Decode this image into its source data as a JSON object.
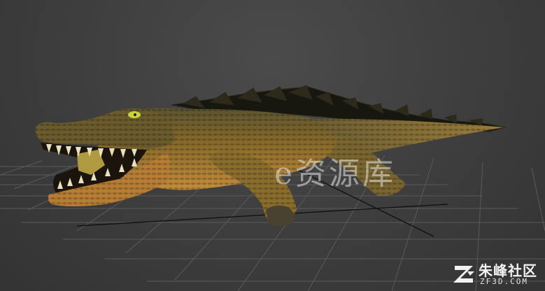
{
  "viewport": {
    "label": "3D viewport – crocodile model"
  },
  "watermark": {
    "text": "e资源库"
  },
  "brand": {
    "name": "朱峰社区",
    "domain": "ZF3D.COM"
  },
  "colors": {
    "background": "#3d3d3d",
    "grid": "#5a5a5a",
    "grid_axis": "#111111",
    "skin": "#8a6a2a",
    "belly": "#c08a3a",
    "spikes": "#1a1a14"
  }
}
